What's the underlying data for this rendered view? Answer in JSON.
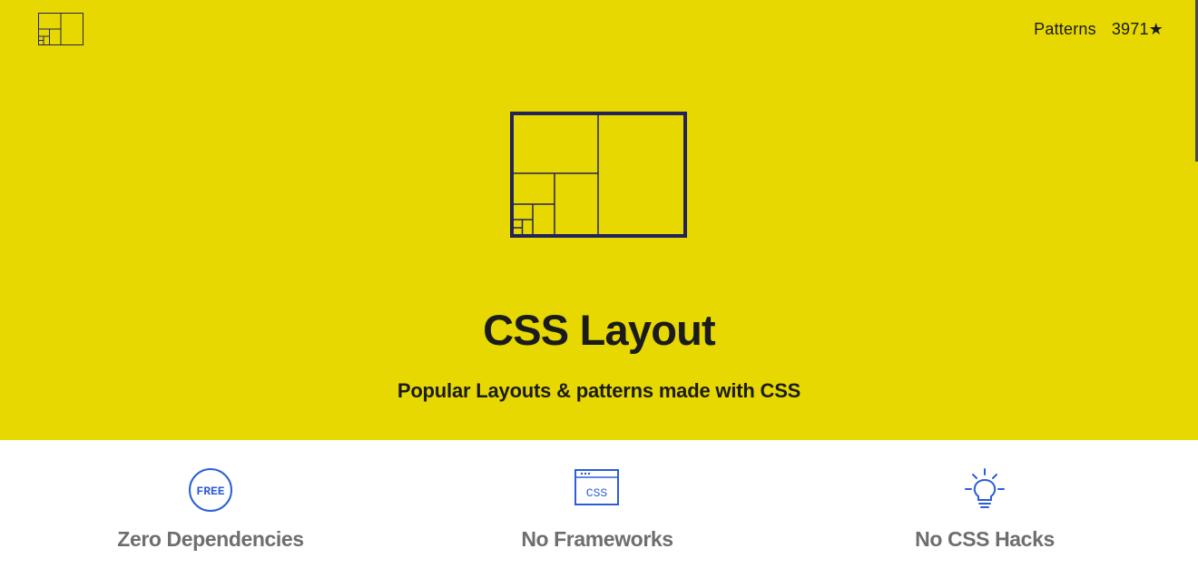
{
  "header": {
    "nav": [
      {
        "label": "Patterns"
      },
      {
        "label": "3971★"
      }
    ]
  },
  "hero": {
    "title": "CSS Layout",
    "subtitle": "Popular Layouts & patterns made with CSS"
  },
  "features": [
    {
      "label": "Zero Dependencies",
      "icon": "free-badge-icon",
      "icon_text": "FREE"
    },
    {
      "label": "No Frameworks",
      "icon": "css-window-icon",
      "icon_text": "CSS"
    },
    {
      "label": "No CSS Hacks",
      "icon": "lightbulb-icon"
    }
  ],
  "colors": {
    "hero_background": "#e6d800",
    "logo_stroke": "#23235a",
    "feature_icon": "#2c5ed8",
    "feature_text": "#6e6e6e"
  }
}
